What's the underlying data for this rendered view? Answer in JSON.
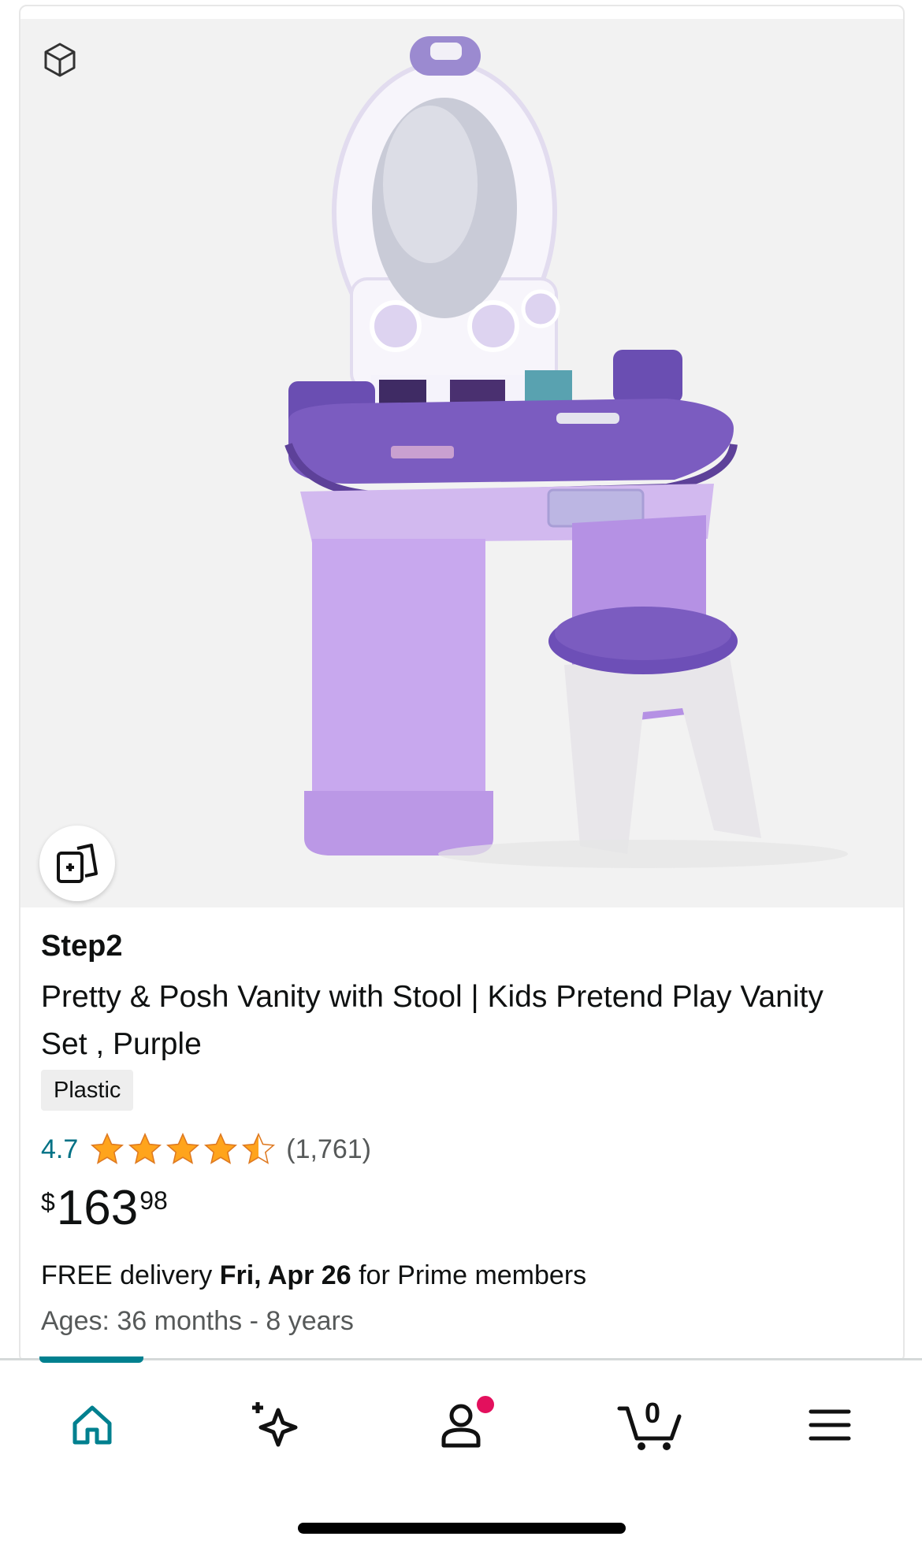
{
  "product": {
    "brand": "Step2",
    "title": "Pretty & Posh Vanity with Stool | Kids Pretend Play Vanity Set , Purple",
    "material_badge": "Plastic",
    "rating_value": "4.7",
    "rating_stars": 4.5,
    "review_count": "(1,761)",
    "price": {
      "symbol": "$",
      "whole": "163",
      "fraction": "98"
    },
    "delivery": {
      "prefix": "FREE delivery ",
      "date": "Fri, Apr 26",
      "suffix": " for Prime members"
    },
    "ages": "Ages: 36 months - 8 years",
    "image_description": "purple kids vanity with mirror and stool"
  },
  "icons": {
    "ar_view": "cube-icon",
    "compare": "compare-cards-icon"
  },
  "nav": {
    "items": [
      {
        "name": "home",
        "icon": "home-icon",
        "active": true
      },
      {
        "name": "ai-sparkle",
        "icon": "sparkle-icon"
      },
      {
        "name": "account",
        "icon": "person-icon",
        "notification": true
      },
      {
        "name": "cart",
        "icon": "cart-icon",
        "count": "0"
      },
      {
        "name": "menu",
        "icon": "hamburger-icon"
      }
    ]
  },
  "colors": {
    "accent_teal": "#00808f",
    "rating_link": "#007185",
    "star": "#ffa41c",
    "notification": "#e3105d",
    "vanity_purple": "#7b5cc0"
  }
}
